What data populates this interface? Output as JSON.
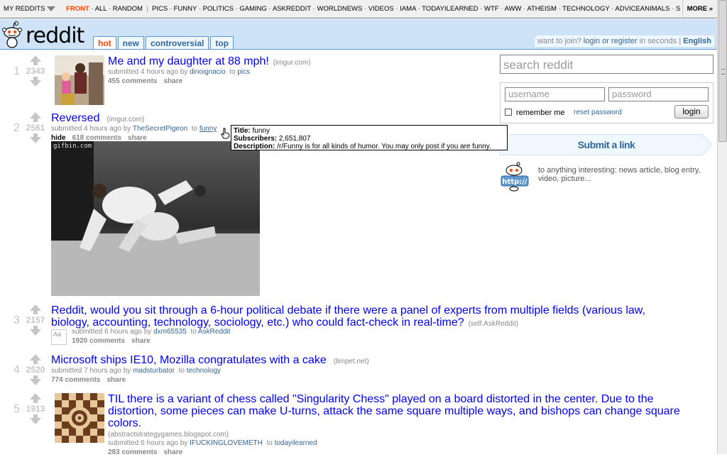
{
  "sr_bar": {
    "my_reddits": "MY REDDITS",
    "specials": [
      "FRONT",
      "ALL",
      "RANDOM"
    ],
    "subreddits": [
      "PICS",
      "FUNNY",
      "POLITICS",
      "GAMING",
      "ASKREDDIT",
      "WORLDNEWS",
      "VIDEOS",
      "IAMA",
      "TODAYILEARNED",
      "WTF",
      "AWW",
      "ATHEISM",
      "TECHNOLOGY",
      "ADVICEANIMALS",
      "S"
    ],
    "more": "MORE »"
  },
  "header": {
    "logo_text": "reddit",
    "tabs": [
      "hot",
      "new",
      "controversial",
      "top"
    ],
    "selected_tab": "hot",
    "user_text_prefix": "want to join?",
    "login_register": "login or register",
    "user_text_suffix": "in seconds",
    "separator": "|",
    "language": "English"
  },
  "side": {
    "search_placeholder": "search reddit",
    "username_placeholder": "username",
    "password_placeholder": "password",
    "remember_me": "remember me",
    "reset_password": "reset password",
    "login_button": "login",
    "submit_link": "Submit a link",
    "submit_desc": "to anything interesting: news article, blog entry, video, picture..."
  },
  "posts": [
    {
      "rank": "1",
      "score": "2343",
      "title": "Me and my daughter at 88 mph!",
      "domain": "(imgur.com)",
      "submitted": "submitted 4 hours ago by",
      "author": "dinoignacio",
      "to": "to",
      "subreddit": "pics",
      "comments": "455 comments",
      "share": "share"
    },
    {
      "rank": "2",
      "score": "2561",
      "title": "Reversed",
      "domain": "(imgur.com)",
      "submitted": "submitted 4 hours ago by",
      "author": "TheSecretPigeon",
      "to": "to",
      "subreddit": "funny",
      "hide": "hide",
      "comments": "618 comments",
      "share": "share",
      "gif_watermark": "gifbin.com"
    },
    {
      "rank": "3",
      "score": "2157",
      "title": "Reddit, would you sit through a 6-hour political debate if there were a panel of experts from multiple fields (various law, biology, accounting, technology, sociology, etc.) who could fact-check in real-time?",
      "domain": "(self.AskReddit)",
      "submitted": "submitted 6 hours ago by",
      "author": "dxm65535",
      "to": "to",
      "subreddit": "AskReddit",
      "comments": "1920 comments",
      "share": "share",
      "self_icon": "Aa"
    },
    {
      "rank": "4",
      "score": "2520",
      "title": "Microsoft ships IE10, Mozilla congratulates with a cake",
      "domain": "(limpet.net)",
      "submitted": "submitted 7 hours ago by",
      "author": "madsturbator",
      "to": "to",
      "subreddit": "technology",
      "comments": "774 comments",
      "share": "share"
    },
    {
      "rank": "5",
      "score": "1913",
      "title": "TIL there is a variant of chess called \"Singularity Chess\" played on a board distorted in the center. Due to the distortion, some pieces can make U-turns, attack the same square multiple ways, and bishops can change square colors.",
      "domain": "(abstractstrategygames.blogspot.com)",
      "submitted": "submitted 6 hours ago by",
      "author": "IFUCKINGLOVEMETH",
      "to": "to",
      "subreddit": "todayilearned",
      "comments": "283 comments",
      "share": "share"
    }
  ],
  "tooltip": {
    "title_label": "Title:",
    "title_value": "funny",
    "subs_label": "Subscribers:",
    "subs_value": "2,651,807",
    "desc_label": "Description:",
    "desc_value": "/r/Funny is for all kinds of humor. You may only post if you are funny."
  }
}
